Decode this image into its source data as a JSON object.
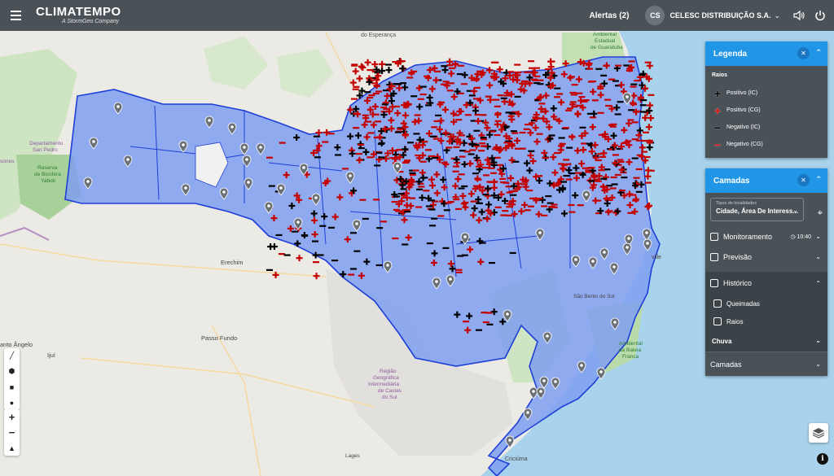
{
  "header": {
    "logo": "CLIMATEMPO",
    "logo_sub": "A StormGeo Company",
    "alerts": "Alertas (2)",
    "avatar": "CS",
    "user": "CELESC DISTRIBUIÇÃO S.A."
  },
  "map_labels": {
    "esperanca": "do Esperança",
    "ambiental": "Ambiental",
    "estadual": "Estadual",
    "guaratuba": "de Guaratuba",
    "departamento": "Departamento",
    "san_pedro": "San Pedro",
    "reserva": "Reserva",
    "biosfera": "de Biosfera",
    "yaboti": "Yaboti",
    "erechim": "Erechim",
    "passo_fundo": "Passo Fundo",
    "santo_angelo": "anto Ângelo",
    "ijui": "Ijuí",
    "regiao": "Região",
    "geografica": "Geográfica",
    "intermediaria": "Intermediária",
    "caxias": "de Caxias",
    "do_sul": "do Sul",
    "sao_bento": "São Bento do Sul",
    "baleia1": "Ambiental",
    "baleia2": "da Baleia",
    "baleia3": "Franca",
    "criciuma": "Criciúma",
    "joinville": "ville",
    "lages": "Lages",
    "sones": "sones"
  },
  "legend": {
    "title": "Legenda",
    "section": "Raios",
    "items": [
      {
        "label": "Positivo (IC)",
        "symbol": "+",
        "color": "#000000"
      },
      {
        "label": "Positivo (CG)",
        "symbol": "+",
        "color": "#c00000"
      },
      {
        "label": "Negativo (IC)",
        "symbol": "−",
        "color": "#000000"
      },
      {
        "label": "Negativo (CG)",
        "symbol": "−",
        "color": "#c00000"
      }
    ]
  },
  "layers_panel": {
    "title": "Camadas",
    "loc_label": "Tipos de localidades",
    "loc_value": "Cidade, Área De Interess...",
    "monitoramento": "Monitoramento",
    "monitor_time": "10:40",
    "previsao": "Previsão",
    "historico": "Histórico",
    "queimadas": "Queimadas",
    "raios": "Raios",
    "chuva": "Chuva",
    "footer": "Camadas"
  },
  "colors": {
    "header": "#4a5258",
    "accent": "#2196e6",
    "region_fill": "#7f9ff0",
    "positive_cg": "#c00000"
  }
}
